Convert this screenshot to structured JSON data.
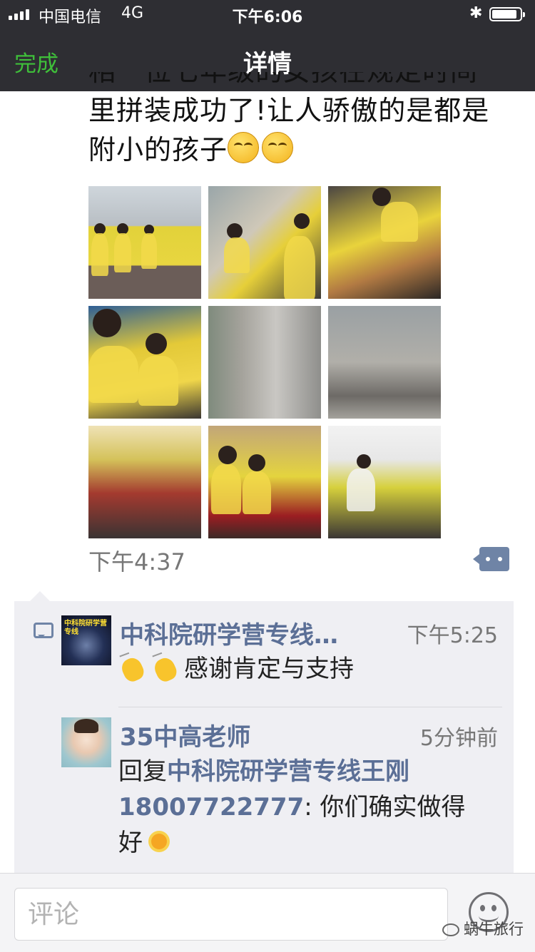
{
  "status_bar": {
    "carrier": "中国电信",
    "network": "4G",
    "time": "下午6:06",
    "bluetooth_icon": "bluetooth-icon",
    "battery_level": 0.9
  },
  "nav": {
    "done_label": "完成",
    "title": "详情"
  },
  "post": {
    "text_line1": "相一位七年级的女孩在规定时间",
    "text_line2": "里拼装成功了!让人骄傲的是都是",
    "text_line3": "附小的孩子",
    "emoji": "smirking-face",
    "photos": [
      "photo-1",
      "photo-2",
      "photo-3",
      "photo-4",
      "photo-5",
      "photo-6",
      "photo-7",
      "photo-8",
      "photo-9"
    ],
    "time": "下午4:37",
    "more_icon": "more-dots-icon"
  },
  "comments": [
    {
      "author": "中科院研学营专线…",
      "time": "下午5:25",
      "text": "感谢肯定与支持",
      "emoji": "clapping-hands",
      "avatar_text": "中科院研学营专线"
    },
    {
      "author": "35中高老师",
      "time": "5分钟前",
      "reply_prefix": "回复",
      "reply_to": "中科院研学营专线王刚",
      "reply_to_2": "18007722777",
      "text_1": ": 你们确实做得",
      "text_2": "好",
      "emoji": "sun"
    }
  ],
  "bottom_bar": {
    "placeholder": "评论",
    "emoji_button_icon": "smiley-face-icon",
    "watermark": "蜗牛旅行"
  },
  "colors": {
    "accent_green": "#3fbf3a",
    "link_blue": "#5b6f96",
    "nav_bg": "#2e2e33",
    "comments_bg": "#efeff3"
  }
}
